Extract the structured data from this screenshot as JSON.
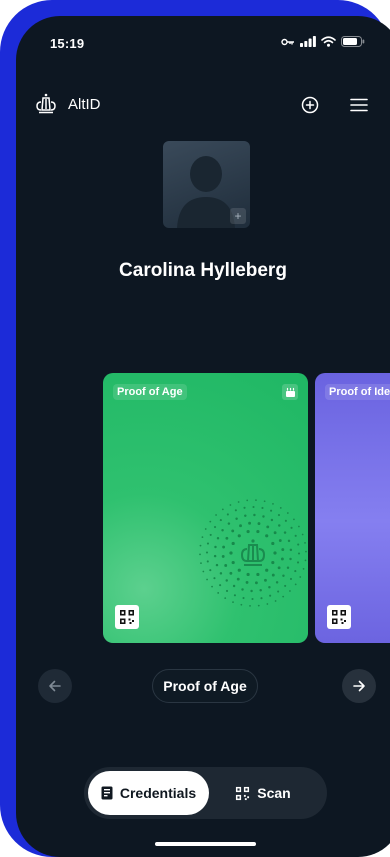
{
  "status_bar": {
    "time": "15:19"
  },
  "header": {
    "app_name": "AltID",
    "add_icon": "plus-circle-icon",
    "menu_icon": "hamburger-menu-icon"
  },
  "profile": {
    "name": "Carolina Hylleberg",
    "avatar_add_label": "+"
  },
  "cards": [
    {
      "label": "Proof of Age",
      "color": "#22b866",
      "corner_icon": "birthday-cake-icon"
    },
    {
      "label": "Proof of Identity",
      "color": "#6f68e4"
    }
  ],
  "carousel": {
    "current_title": "Proof of Age"
  },
  "tabs": [
    {
      "label": "Credentials",
      "icon": "id-card-icon",
      "active": true
    },
    {
      "label": "Scan",
      "icon": "qr-scan-icon",
      "active": false
    }
  ],
  "colors": {
    "background": "#0d1722",
    "frame": "#1c2bd8",
    "tab_active": "#ffffff"
  }
}
